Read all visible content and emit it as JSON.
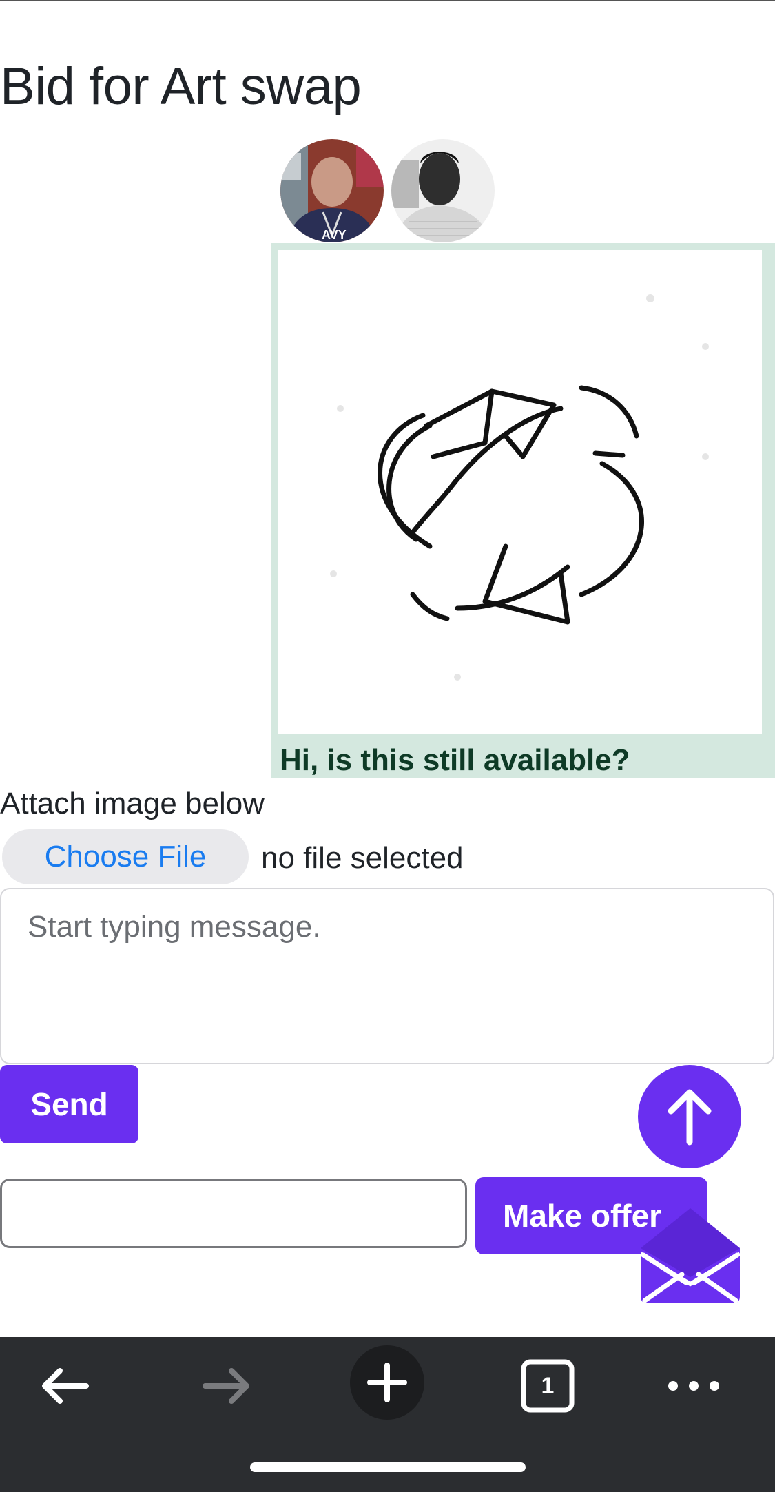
{
  "page": {
    "title": "Bid for Art swap"
  },
  "participants": [
    {
      "name": "avatar-user-1",
      "colors": {
        "bg": "#8a3a2e",
        "shirt": "#2a2f55",
        "skin": "#c99a86"
      }
    },
    {
      "name": "avatar-user-2",
      "colors": {
        "bg": "#f2f2f2",
        "shirt": "#d8d8d8",
        "skin": "#3a3a3a"
      }
    }
  ],
  "message": {
    "text": "Hi, is this still available?",
    "image_icon": "swap-arrows-icon",
    "bubble_color": "#d4e8df"
  },
  "attachment": {
    "label": "Attach image below",
    "button_label": "Choose File",
    "status": "no file selected"
  },
  "composer": {
    "placeholder": "Start typing message.",
    "value": "",
    "send_label": "Send"
  },
  "offer": {
    "value": "",
    "button_label": "Make offer"
  },
  "floating": {
    "scroll_top_icon": "arrow-up-icon",
    "mail_icon": "mail-icon"
  },
  "browser_toolbar": {
    "back_icon": "arrow-left-icon",
    "forward_icon": "arrow-right-icon",
    "new_tab_icon": "plus-icon",
    "tab_count": "1",
    "menu_icon": "more-horizontal-icon"
  },
  "colors": {
    "accent": "#6a2ff0",
    "toolbar": "#2b2d30",
    "link": "#1a7cf0"
  }
}
